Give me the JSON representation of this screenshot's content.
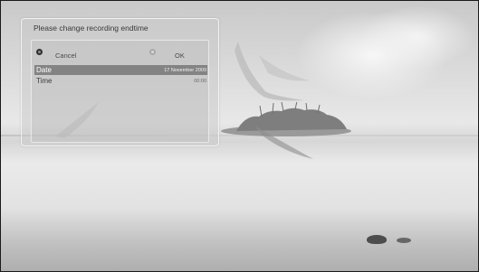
{
  "dialog": {
    "title": "Please change recording endtime",
    "buttons": {
      "cancel_label": "Cancel",
      "ok_label": "OK"
    },
    "fields": [
      {
        "label": "Date",
        "value": "17 November 2009",
        "selected": true
      },
      {
        "label": "Time",
        "value": "00:00",
        "selected": false
      }
    ]
  },
  "colors": {
    "selected_row": "#838383",
    "dialog_border": "#f5f5f5"
  }
}
